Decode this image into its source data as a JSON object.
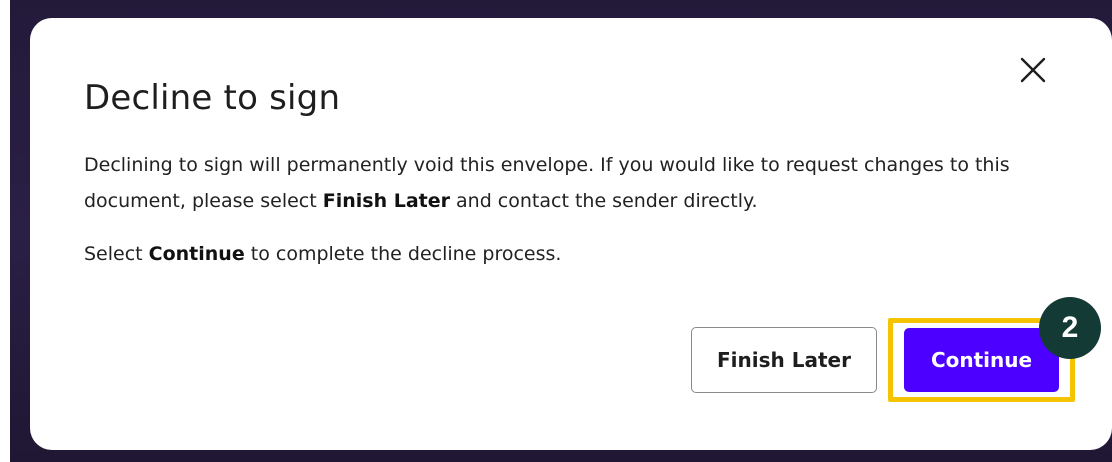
{
  "dialog": {
    "title": "Decline to sign",
    "close_icon": "close-icon",
    "paragraph1": {
      "part1": "Declining to sign will permanently void this envelope. If you would like to request changes to this document, please select ",
      "bold": "Finish Later",
      "part2": " and contact the sender directly."
    },
    "paragraph2": {
      "part1": "Select ",
      "bold": "Continue",
      "part2": " to complete the decline process."
    },
    "buttons": {
      "finish_later": "Finish Later",
      "continue": "Continue"
    }
  },
  "annotation": {
    "step_number": "2",
    "highlight_color": "#f5c400",
    "badge_color": "#143a35"
  },
  "colors": {
    "primary": "#4c00ff",
    "backdrop": "#231a3a"
  }
}
